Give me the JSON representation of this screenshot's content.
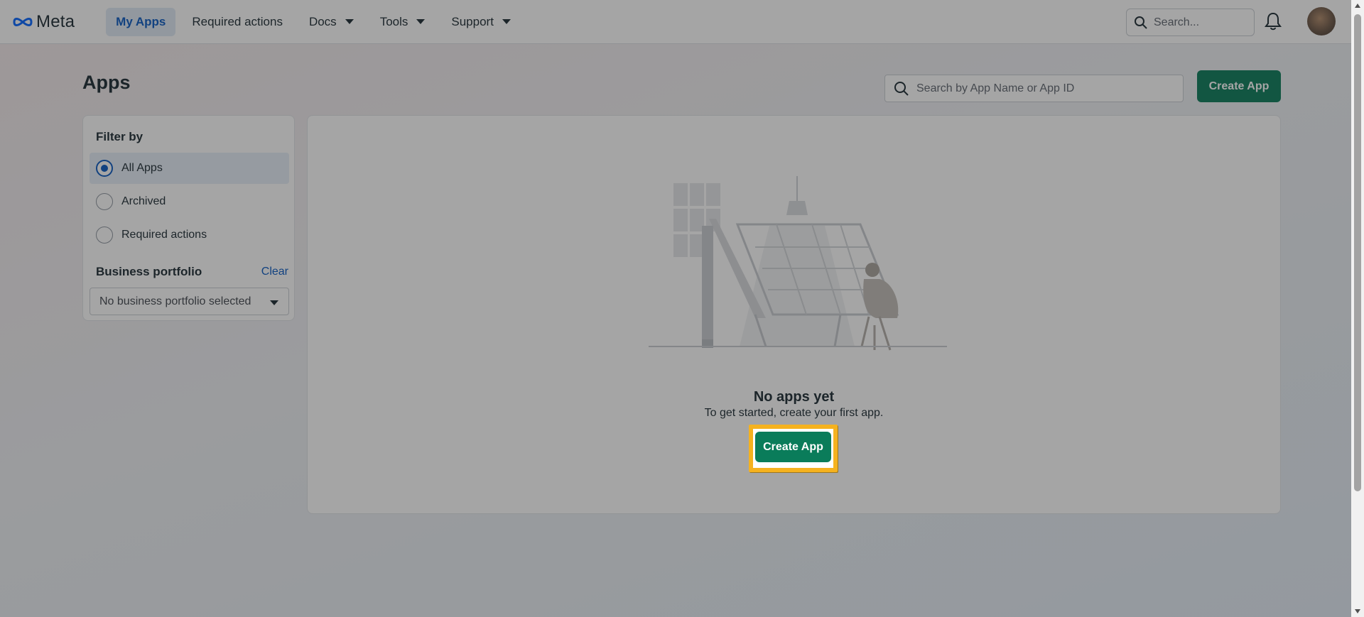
{
  "topbar": {
    "logo_text": "Meta",
    "nav": [
      {
        "label": "My Apps",
        "active": true,
        "dropdown": false
      },
      {
        "label": "Required actions",
        "active": false,
        "dropdown": false
      },
      {
        "label": "Docs",
        "active": false,
        "dropdown": true
      },
      {
        "label": "Tools",
        "active": false,
        "dropdown": true
      },
      {
        "label": "Support",
        "active": false,
        "dropdown": true
      }
    ],
    "search_placeholder": "Search..."
  },
  "page": {
    "title": "Apps",
    "search_placeholder": "Search by App Name or App ID",
    "create_app_label": "Create App"
  },
  "filter": {
    "title": "Filter by",
    "options": [
      {
        "label": "All Apps",
        "selected": true
      },
      {
        "label": "Archived",
        "selected": false
      },
      {
        "label": "Required actions",
        "selected": false
      }
    ],
    "business_portfolio_title": "Business portfolio",
    "clear_label": "Clear",
    "business_portfolio_value": "No business portfolio selected"
  },
  "empty_state": {
    "title": "No apps yet",
    "subtitle": "To get started, create your first app.",
    "button_label": "Create App"
  },
  "colors": {
    "primary_button": "#0a7c5a",
    "link_blue": "#0a5ac2",
    "highlight": "#f5b21f",
    "overlay": "rgba(30,30,30,0.40)"
  }
}
